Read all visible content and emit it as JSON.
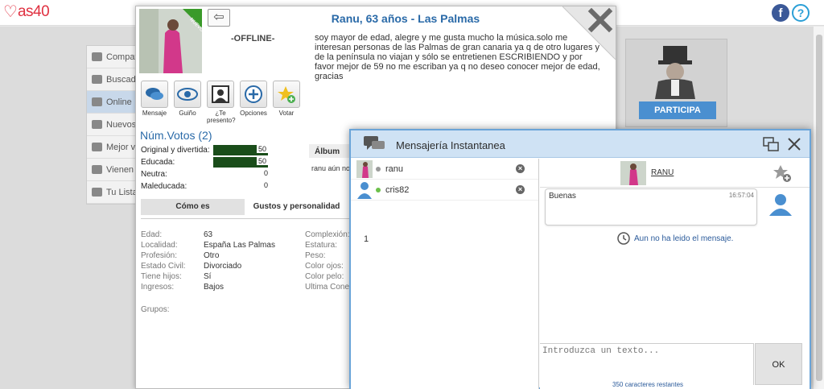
{
  "app": {
    "logo_text": "as40"
  },
  "top_icons": {
    "facebook": "f",
    "help": "?"
  },
  "sidebar": {
    "items": [
      {
        "label": "Compati"
      },
      {
        "label": "Buscado"
      },
      {
        "label": "Online"
      },
      {
        "label": "Nuevos"
      },
      {
        "label": "Mejor vo"
      },
      {
        "label": "Vienen e"
      },
      {
        "label": "Tu Lista"
      }
    ]
  },
  "promo": {
    "button_label": "PARTICIPA"
  },
  "profile": {
    "title": "Ranu, 63 años - Las Palmas",
    "photo_badge": "NUEVO",
    "status": "-OFFLINE-",
    "description": "soy mayor de edad, alegre y me gusta mucho la música.solo me interesan personas de las Palmas de gran canaria ya q de otro lugares y de la península no viajan y sólo se entretienen ESCRIBIENDO y por favor mejor de 59 no me escriban ya q no deseo conocer mejor de edad, gracias",
    "actions": [
      {
        "label": "Mensaje"
      },
      {
        "label": "Guiño"
      },
      {
        "label": "¿Te presento?"
      },
      {
        "label": "Opciones"
      },
      {
        "label": "Votar"
      }
    ],
    "votes_title": "Núm.Votos (2)",
    "votes": [
      {
        "label": "Original y divertida:",
        "value": "50",
        "fill": 1.0
      },
      {
        "label": "Educada:",
        "value": "50",
        "fill": 1.0
      },
      {
        "label": "Neutra:",
        "value": "0",
        "fill": 0
      },
      {
        "label": "Maleducada:",
        "value": "0",
        "fill": 0
      }
    ],
    "album_label": "Álbum",
    "album_text": "ranu aún no",
    "tabs": [
      {
        "label": "Cómo es"
      },
      {
        "label": "Gustos y personalidad"
      }
    ],
    "details_left": [
      {
        "key": "Edad:",
        "value": "63"
      },
      {
        "key": "Localidad:",
        "value": "España Las Palmas"
      },
      {
        "key": "Profesión:",
        "value": "Otro"
      },
      {
        "key": "Estado Civil:",
        "value": "Divorciado"
      },
      {
        "key": "Tiene hijos:",
        "value": "Sí"
      },
      {
        "key": "Ingresos:",
        "value": "Bajos"
      }
    ],
    "details_right": [
      {
        "key": "Complexión:"
      },
      {
        "key": "Estatura:"
      },
      {
        "key": "Peso:"
      },
      {
        "key": "Color ojos:"
      },
      {
        "key": "Color pelo:"
      },
      {
        "key": "Ultima Conex"
      }
    ],
    "groups_label": "Grupos:"
  },
  "im": {
    "title": "Mensajería Instantanea",
    "contacts": [
      {
        "name": "ranu",
        "status_color": "#9a9a9a"
      },
      {
        "name": "cris82",
        "status_color": "#6cc04a"
      }
    ],
    "unread_count": "1",
    "chat": {
      "name": "RANU",
      "message": "Buenas",
      "time": "16:57:04",
      "read_note": "Aun no ha leido el mensaje.",
      "input_placeholder": "Introduzca un texto...",
      "send_label": "OK",
      "remaining": "350 caracteres restantes"
    }
  },
  "colors": {
    "accent": "#2a6aa8",
    "im_border": "#6aa4d8",
    "vote_bar": "#1a4d1a",
    "brand": "#e03040"
  }
}
